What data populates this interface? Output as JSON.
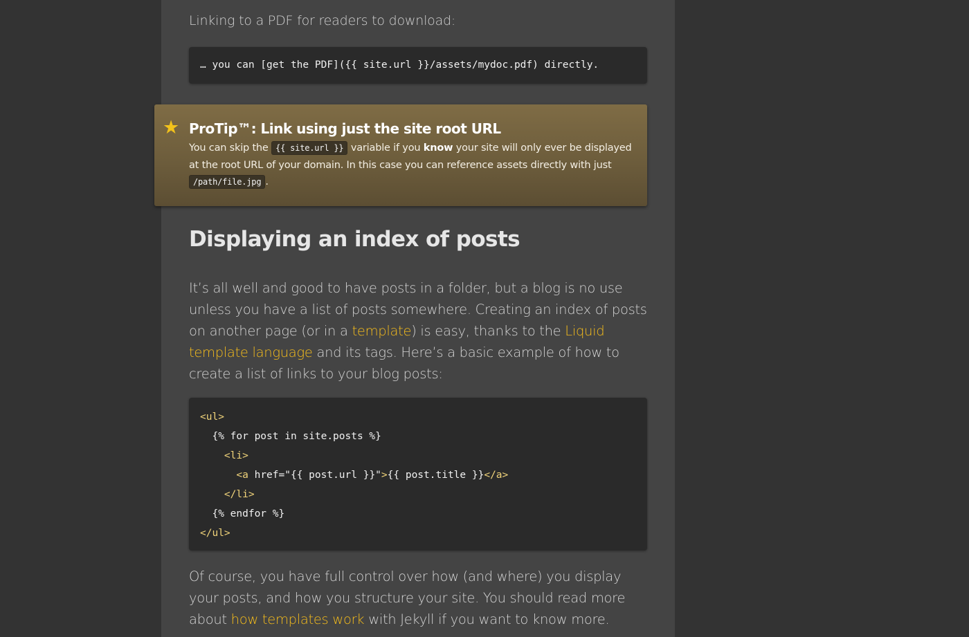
{
  "intro_text": "Linking to a PDF for readers to download:",
  "code_pdf": "… you can [get the PDF]({{ site.url }}/assets/mydoc.pdf) directly.",
  "protip": {
    "icon": "star-icon",
    "title": "ProTip™: Link using just the site root URL",
    "body_part1": "You can skip the",
    "code1": "{{ site.url }}",
    "body_part2": "variable if you",
    "bold": "know",
    "body_part3": "your site will only ever be displayed at the root URL of your domain. In this case you can reference assets directly with just",
    "code2": "/path/file.jpg",
    "body_end": "."
  },
  "heading": "Displaying an index of posts",
  "para1": {
    "part1": "It’s all well and good to have posts in a folder, but a blog is no use unless you have a list of posts somewhere. Creating an index of posts on another page (or in a",
    "link1": "template",
    "part2": ") is easy, thanks to the",
    "link2": "Liquid template language",
    "part3": "and its tags. Here’s a basic example of how to create a list of links to your blog posts:"
  },
  "code_list": {
    "l1_tag": "<ul>",
    "l2": "  {% for post in site.posts %}",
    "l3_tag": "    <li>",
    "l4_indent": "      ",
    "l4_tag_open": "<a",
    "l4_attr": " href=\"{{ post.url }}\"",
    "l4_gt": ">",
    "l4_text": "{{ post.title }}",
    "l4_tag_close": "</a>",
    "l5_tag": "    </li>",
    "l6": "  {% endfor %}",
    "l7_tag": "</ul>"
  },
  "para2": {
    "part1": "Of course, you have full control over how (and where) you display your posts, and how you structure your site. You should read more about",
    "link": "how templates work",
    "part2": "with Jekyll if you want to know more."
  },
  "colors": {
    "page_bg": "#333333",
    "column_bg": "#444444",
    "code_bg": "#2a2a2a",
    "link": "#f6bd1c",
    "tip_bg": "#7f6c45",
    "star": "#f2c21b"
  }
}
